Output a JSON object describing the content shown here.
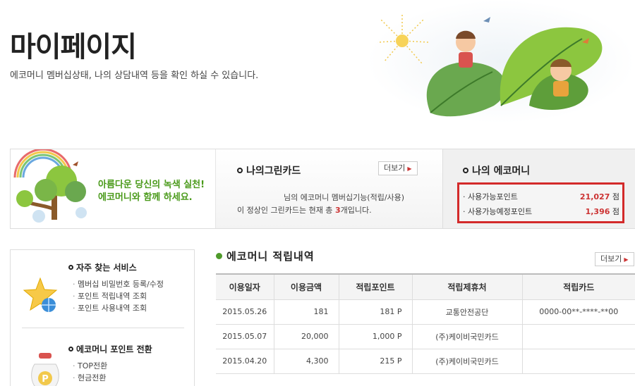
{
  "page": {
    "title": "마이페이지",
    "description": "에코머니 멤버십상태, 나의 상담내역 등을 확인 하실 수 있습니다."
  },
  "promo": {
    "line1": "아름다운 당신의 녹색 실천!",
    "line2": "에코머니와 함께 하세요."
  },
  "green_card": {
    "title": "나의그린카드",
    "more_label": "더보기",
    "line1": "님의 에코머니 멤버십기능(적립/사용)",
    "line2_prefix": "이 정상인 그린카드는 현재 총 ",
    "count": "3",
    "line2_suffix": "개입니다."
  },
  "eco_money": {
    "title": "나의 에코머니",
    "rows": [
      {
        "label": "사용가능포인트",
        "value": "21,027",
        "unit": "점"
      },
      {
        "label": "사용가능예정포인트",
        "value": "1,396",
        "unit": "점"
      }
    ]
  },
  "services": {
    "frequent_title": "자주 찾는 서비스",
    "frequent_items": [
      "멤버십 비밀번호 등록/수정",
      "포인트 적립내역 조회",
      "포인트 사용내역 조회"
    ],
    "convert_title": "에코머니 포인트 전환",
    "convert_items": [
      "TOP전환",
      "현금전환"
    ]
  },
  "history": {
    "title": "에코머니 적립내역",
    "more_label": "더보기",
    "columns": [
      "이용일자",
      "이용금액",
      "적립포인트",
      "적립제휴처",
      "적립카드"
    ],
    "rows": [
      [
        "2015.05.26",
        "181",
        "181 P",
        "교통안전공단",
        "0000-00**-****-**00"
      ],
      [
        "2015.05.07",
        "20,000",
        "1,000 P",
        "(주)케이비국민카드",
        ""
      ],
      [
        "2015.04.20",
        "4,300",
        "215 P",
        "(주)케이비국민카드",
        ""
      ]
    ]
  },
  "colors": {
    "accent_green": "#4e9a2a",
    "highlight_red": "#d32a2a",
    "point_red": "#cc3333"
  }
}
